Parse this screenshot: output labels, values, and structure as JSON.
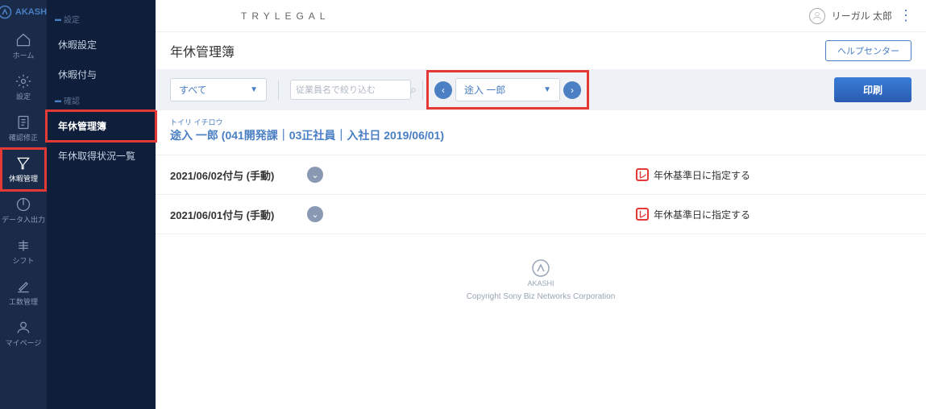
{
  "brand": "AKASHI",
  "company": "TRYLEGAL",
  "user": {
    "name": "リーガル 太郎"
  },
  "sidebar_main": {
    "items": [
      {
        "label": "ホーム"
      },
      {
        "label": "設定"
      },
      {
        "label": "確認修正"
      },
      {
        "label": "休暇管理"
      },
      {
        "label": "データ入出力"
      },
      {
        "label": "シフト"
      },
      {
        "label": "工数管理"
      },
      {
        "label": "マイページ"
      }
    ]
  },
  "sidebar_sub": {
    "group1_label": "設定",
    "group1_items": [
      {
        "label": "休暇設定"
      },
      {
        "label": "休暇付与"
      }
    ],
    "group2_label": "確認",
    "group2_items": [
      {
        "label": "年休管理簿"
      },
      {
        "label": "年休取得状況一覧"
      }
    ]
  },
  "page": {
    "title": "年休管理簿",
    "help_label": "ヘルプセンター"
  },
  "filters": {
    "scope_value": "すべて",
    "search_placeholder": "従業員名で絞り込む",
    "employee_value": "途入 一郎",
    "print_label": "印刷"
  },
  "detail": {
    "ruby": "トイリ イチロウ",
    "headline": "途入 一郎 (041開発課｜03正社員｜入社日 2019/06/01)"
  },
  "records": [
    {
      "title": "2021/06/02付与 (手動)",
      "action": "年休基準日に指定する"
    },
    {
      "title": "2021/06/01付与 (手動)",
      "action": "年休基準日に指定する"
    }
  ],
  "footer": {
    "brand": "AKASHI",
    "copyright": "Copyright Sony Biz Networks Corporation"
  }
}
